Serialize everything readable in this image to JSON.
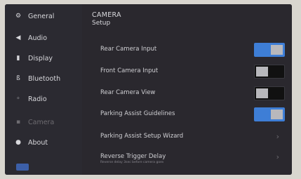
{
  "sidebar": {
    "items": [
      {
        "icon": "gear-icon",
        "glyph": "⚙",
        "label": "General"
      },
      {
        "icon": "speaker-icon",
        "glyph": "◀",
        "label": "Audio"
      },
      {
        "icon": "display-icon",
        "glyph": "▮",
        "label": "Display"
      },
      {
        "icon": "bluetooth-icon",
        "glyph": "ß",
        "label": "Bluetooth"
      },
      {
        "icon": "radio-icon",
        "glyph": "◦",
        "label": "Radio"
      },
      {
        "icon": "camera-icon",
        "glyph": "▪",
        "label": "Camera"
      },
      {
        "icon": "info-icon",
        "glyph": "●",
        "label": "About"
      }
    ]
  },
  "header": {
    "title": "CAMERA",
    "subtitle": "Setup"
  },
  "settings": [
    {
      "label": "Rear Camera Input",
      "type": "toggle",
      "state": "on"
    },
    {
      "label": "Front Camera Input",
      "type": "toggle",
      "state": "off"
    },
    {
      "label": "Rear Camera View",
      "type": "toggle",
      "state": "off"
    },
    {
      "label": "Parking Assist Guidelines",
      "type": "toggle",
      "state": "on"
    },
    {
      "label": "Parking Assist Setup Wizard",
      "type": "link",
      "chevron": "›"
    },
    {
      "label": "Reverse Trigger Delay",
      "type": "link",
      "chevron": "›",
      "sub": "Reverse delay 3sec before camera goes"
    }
  ],
  "colors": {
    "accent": "#3e7ed6",
    "background": "#2a282e",
    "sidebar": "#2b2a31"
  }
}
